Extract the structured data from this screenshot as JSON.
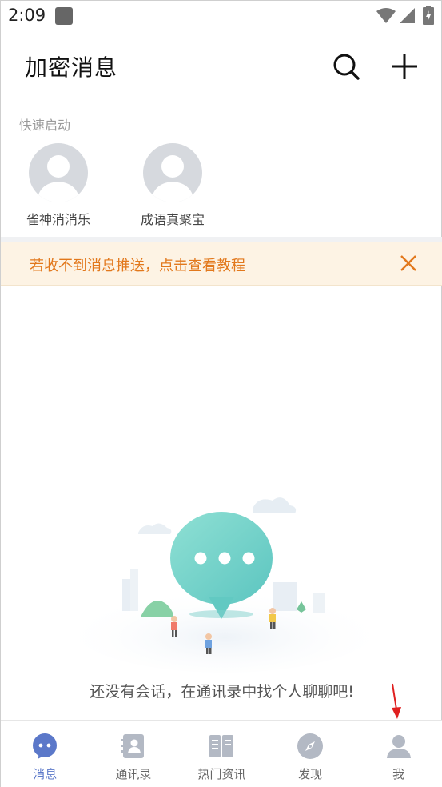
{
  "status_bar": {
    "time": "2:09"
  },
  "header": {
    "title": "加密消息",
    "search_icon": "search-icon",
    "add_icon": "plus-icon"
  },
  "quick_launch": {
    "title": "快速启动",
    "items": [
      {
        "label": "雀神消消乐",
        "icon": "avatar-placeholder-icon"
      },
      {
        "label": "成语真聚宝",
        "icon": "avatar-placeholder-icon"
      }
    ]
  },
  "notice": {
    "text": "若收不到消息推送，点击查看教程",
    "close_icon": "close-icon"
  },
  "empty_state": {
    "text": "还没有会话，在通讯录中找个人聊聊吧!"
  },
  "bottom_nav": {
    "items": [
      {
        "label": "消息",
        "icon": "chat-bubble-icon",
        "active": true
      },
      {
        "label": "通讯录",
        "icon": "contacts-icon",
        "active": false
      },
      {
        "label": "热门资讯",
        "icon": "book-icon",
        "active": false
      },
      {
        "label": "发现",
        "icon": "compass-icon",
        "active": false
      },
      {
        "label": "我",
        "icon": "person-icon",
        "active": false
      }
    ]
  },
  "colors": {
    "accent": "#5b78c9",
    "inactive_icon": "#b3b9c4",
    "notice_text": "#e2781c",
    "notice_bg": "#fdf3e4",
    "annotation_arrow": "#e02020"
  }
}
